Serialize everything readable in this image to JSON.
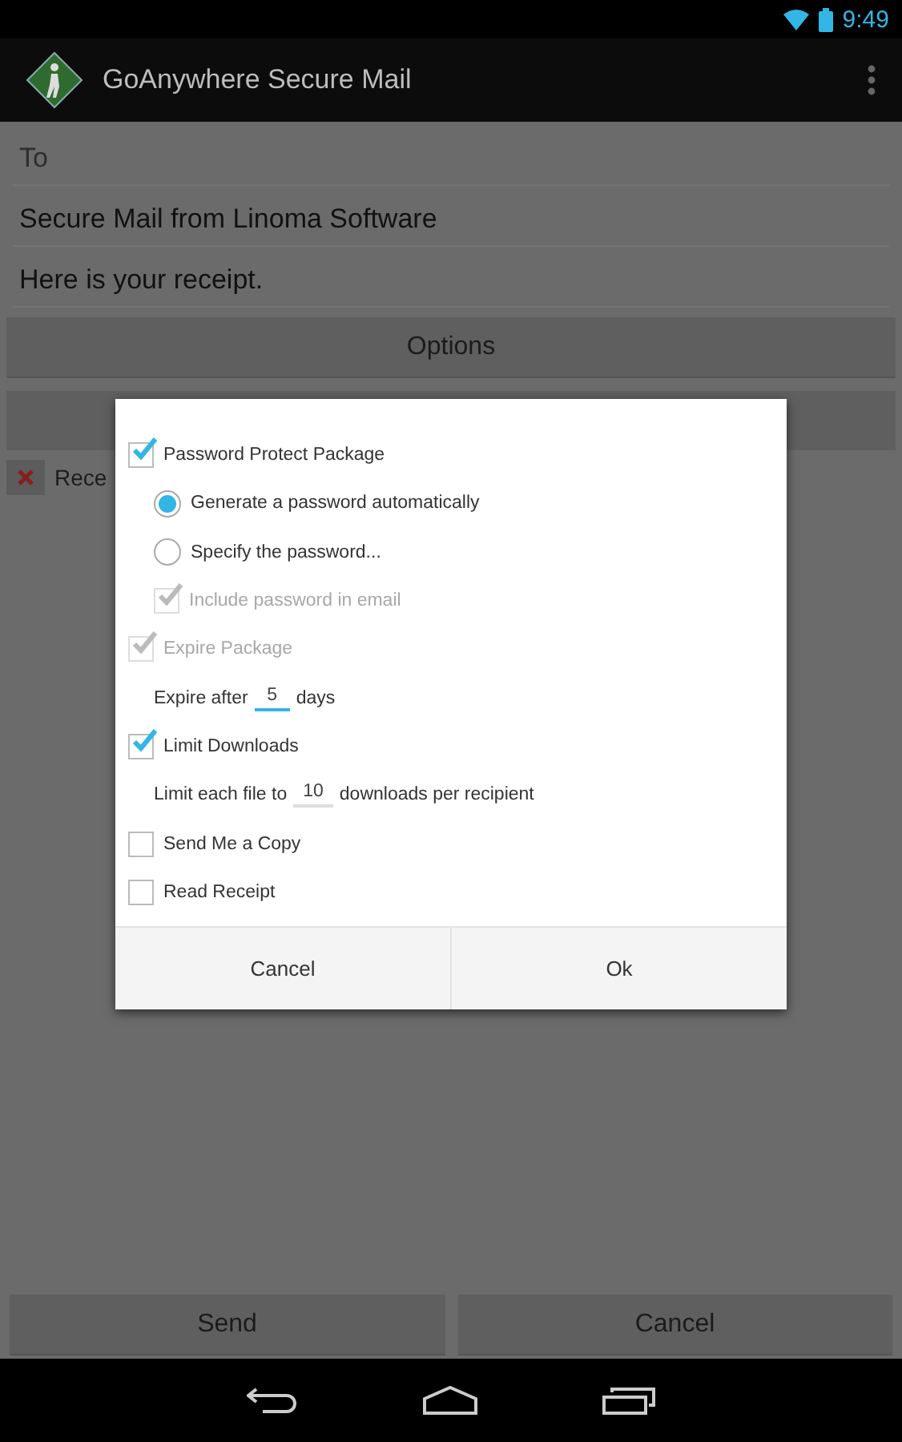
{
  "status_bar": {
    "time": "9:49"
  },
  "action_bar": {
    "title": "GoAnywhere Secure Mail"
  },
  "compose": {
    "to": {
      "placeholder": "To"
    },
    "subject": {
      "value": "Secure Mail from Linoma Software"
    },
    "body": {
      "value": "Here is your receipt."
    },
    "options_button": "Options",
    "attachment": {
      "name": "Rece"
    }
  },
  "dialog": {
    "items": [
      {
        "kind": "checkbox",
        "label": "Password Protect Package",
        "checked": true,
        "disabled": false,
        "children": [
          {
            "kind": "radio",
            "label": "Generate a password automatically",
            "selected": true
          },
          {
            "kind": "radio",
            "label": "Specify the password...",
            "selected": false
          },
          {
            "kind": "checkbox",
            "label": "Include password in email",
            "checked": true,
            "disabled": true
          }
        ]
      },
      {
        "kind": "checkbox",
        "label": "Expire Package",
        "checked": true,
        "disabled": true,
        "children": [
          {
            "kind": "number",
            "before": "Expire after",
            "value": "5",
            "after": "days",
            "focused": true
          }
        ]
      },
      {
        "kind": "checkbox",
        "label": "Limit Downloads",
        "checked": true,
        "disabled": false,
        "children": [
          {
            "kind": "number",
            "before": "Limit each file to",
            "value": "10",
            "after": "downloads per recipient",
            "focused": false
          }
        ]
      },
      {
        "kind": "checkbox",
        "label": "Send Me a Copy",
        "checked": false,
        "disabled": false
      },
      {
        "kind": "checkbox",
        "label": "Read Receipt",
        "checked": false,
        "disabled": false
      }
    ],
    "buttons": [
      "Cancel",
      "Ok"
    ]
  },
  "bottom_buttons": [
    "Send",
    "Cancel"
  ]
}
